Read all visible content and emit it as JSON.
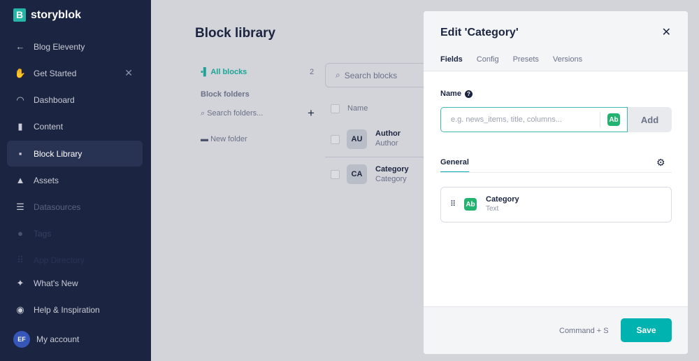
{
  "brand": {
    "name": "storyblok",
    "mark": "B"
  },
  "sidebar": {
    "items": [
      {
        "label": "Blog Eleventy",
        "icon": "arrow-left-icon"
      },
      {
        "label": "Get Started",
        "icon": "hand-wave-icon"
      },
      {
        "label": "Dashboard",
        "icon": "dashboard-icon"
      },
      {
        "label": "Content",
        "icon": "content-icon"
      },
      {
        "label": "Block Library",
        "icon": "block-library-icon"
      },
      {
        "label": "Assets",
        "icon": "assets-icon"
      },
      {
        "label": "Datasources",
        "icon": "datasources-icon"
      },
      {
        "label": "Tags",
        "icon": "tag-icon"
      },
      {
        "label": "App Directory",
        "icon": "apps-icon"
      },
      {
        "label": "What's New",
        "icon": "magic-wand-icon"
      },
      {
        "label": "Help & Inspiration",
        "icon": "lifebuoy-icon"
      }
    ],
    "account": {
      "initials": "EF",
      "label": "My account"
    }
  },
  "library": {
    "title": "Block library",
    "all_blocks": "All blocks",
    "count": "2",
    "folders_heading": "Block folders",
    "folder_search_placeholder": "Search folders...",
    "folders": [
      "New folder"
    ],
    "search_placeholder": "Search blocks",
    "name_header": "Name",
    "rows": [
      {
        "initials": "AU",
        "name": "Author",
        "tech": "Author"
      },
      {
        "initials": "CA",
        "name": "Category",
        "tech": "Category"
      }
    ]
  },
  "panel": {
    "title": "Edit 'Category'",
    "tabs": [
      "Fields",
      "Config",
      "Presets",
      "Versions"
    ],
    "name_label": "Name",
    "name_placeholder": "e.g. news_items, title, columns...",
    "type_badge": "Ab",
    "add_label": "Add",
    "group_tab": "General",
    "fields": [
      {
        "name": "Category",
        "type": "Text",
        "badge": "Ab"
      }
    ],
    "shortcut": "Command + S",
    "save_label": "Save"
  },
  "colors": {
    "accent": "#00b3b0",
    "sidebar": "#1b2440",
    "field_badge": "#21b36f"
  }
}
